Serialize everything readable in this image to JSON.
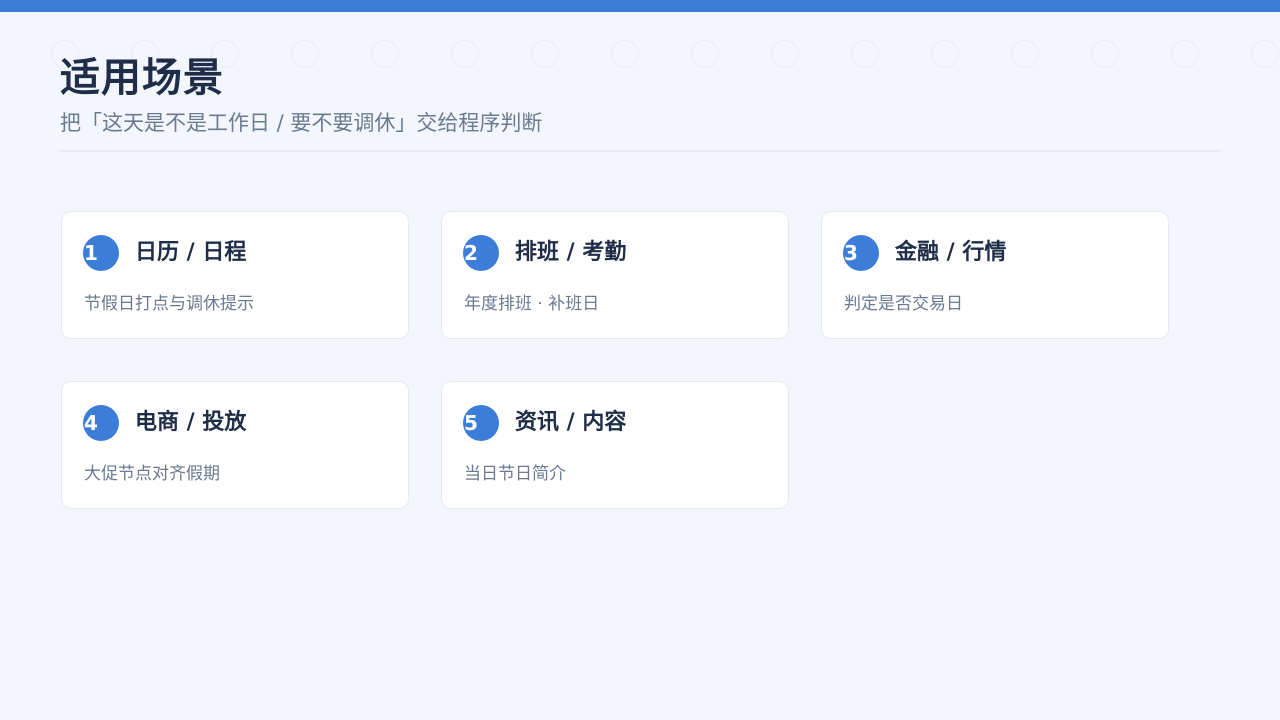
{
  "header": {
    "title": "适用场景",
    "subtitle": "把「这天是不是工作日 / 要不要调休」交给程序判断"
  },
  "cards": [
    {
      "num": "1",
      "title": "日历 / 日程",
      "desc": "节假日打点与调休提示"
    },
    {
      "num": "2",
      "title": "排班 / 考勤",
      "desc": "年度排班 · 补班日"
    },
    {
      "num": "3",
      "title": "金融 / 行情",
      "desc": "判定是否交易日"
    },
    {
      "num": "4",
      "title": "电商 / 投放",
      "desc": "大促节点对齐假期"
    },
    {
      "num": "5",
      "title": "资讯 / 内容",
      "desc": "当日节日简介"
    }
  ],
  "colors": {
    "accent": "#3b7dd8",
    "background": "#f3f7fd",
    "title": "#1f2d48",
    "muted": "#6b7a90"
  }
}
